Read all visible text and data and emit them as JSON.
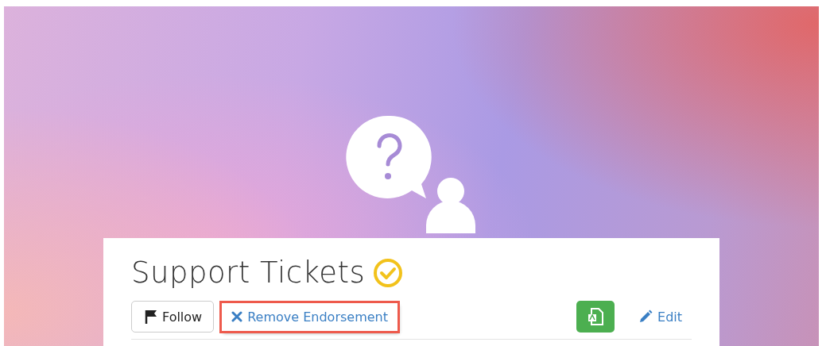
{
  "header": {
    "title": "Support Tickets",
    "verified": true
  },
  "actions": [
    {
      "kind": "follow",
      "label": "Follow"
    },
    {
      "kind": "remove",
      "label": "Remove Endorsement",
      "highlighted": true
    },
    {
      "kind": "export"
    },
    {
      "kind": "edit",
      "label": "Edit",
      "highlighted": false
    }
  ]
}
